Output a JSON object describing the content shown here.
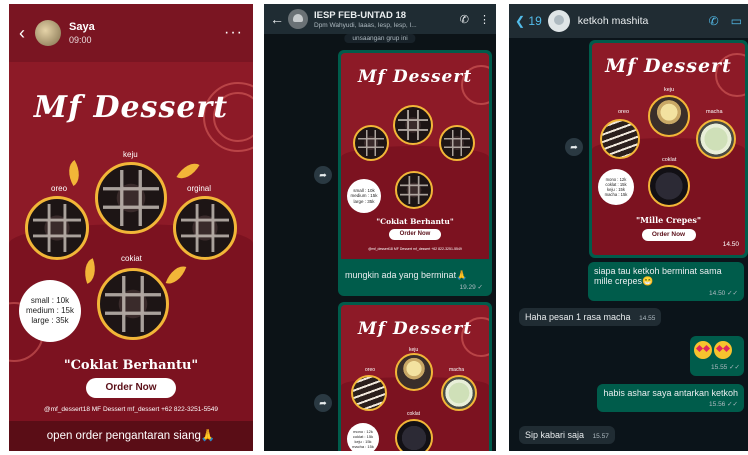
{
  "status": {
    "name": "Saya",
    "time": "09:00",
    "caption": "open order pengantaran siang🙏"
  },
  "poster": {
    "brand": "Mf Dessert",
    "labels_coklat": {
      "keju": "keju",
      "oreo": "oreo",
      "original": "orginal",
      "coklat": "cokiat"
    },
    "labels_crepes": {
      "keju": "keju",
      "oreo": "oreo",
      "macha": "macha",
      "coklat": "coklat"
    },
    "prices_coklat": [
      "small : 10k",
      "medium : 15k",
      "large : 35k"
    ],
    "prices_crepes": [
      "mono : 12k",
      "coklat : 15k",
      "keju : 15k",
      "macha : 15k"
    ],
    "title_coklat": "\"Coklat Berhantu\"",
    "title_crepes": "\"Mille Crepes\"",
    "order_button": "Order Now",
    "socials": "@mf_dessert18  MF Dessert  mf_dessert  +62 822-3251-5549"
  },
  "group": {
    "title": "IESP FEB-UNTAD 18",
    "members": "Dpm Wahyudi, Iaaas, Iesp, Iesp, I...",
    "system_note": "unsaangan grup ini",
    "caption": "mungkin ada yang berminat🙏",
    "caption_time": "19.29 ✓"
  },
  "chat": {
    "back_count": "19",
    "contact": "ketkoh mashita",
    "image_time": "14.50",
    "messages": [
      {
        "dir": "out",
        "text": "siapa tau ketkoh berminat sama mille crepes😁",
        "time": "14.50 ✓✓"
      },
      {
        "dir": "in",
        "text": "Haha pesan 1 rasa macha",
        "time": "14.55"
      },
      {
        "dir": "out",
        "text": "",
        "time": "15.55 ✓✓"
      },
      {
        "dir": "out",
        "text": "habis ashar saya antarkan ketkoh",
        "time": "15.56 ✓✓"
      },
      {
        "dir": "in",
        "text": "Sip kabari saja",
        "time": "15.57"
      }
    ]
  }
}
